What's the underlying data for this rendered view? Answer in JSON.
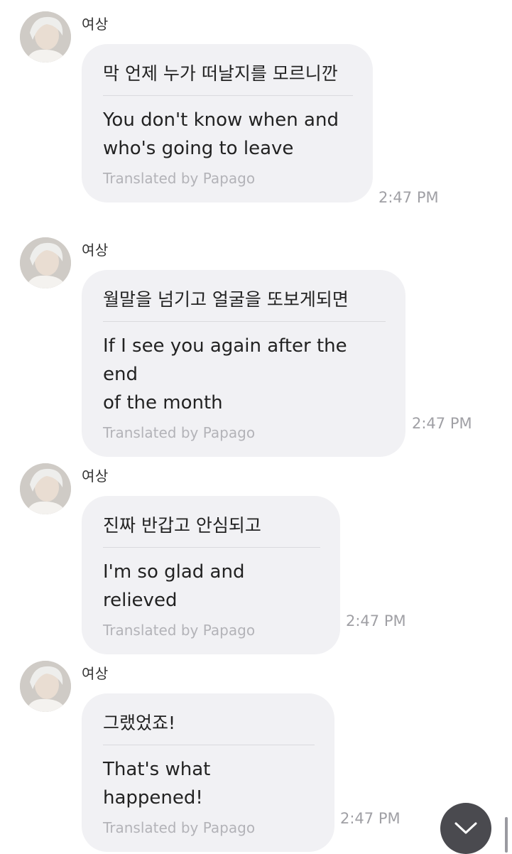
{
  "messages": [
    {
      "sender": "여상",
      "original": "막 언제 누가 떠날지를 모르니깐",
      "translation_lines": [
        "You don't know when and",
        "who's going to leave"
      ],
      "credit": "Translated by Papago",
      "time": "2:47 PM"
    },
    {
      "sender": "여상",
      "original": "월말을 넘기고 얼굴을 또보게되면",
      "translation_lines": [
        "If I see you again after the end",
        "of the month"
      ],
      "credit": "Translated by Papago",
      "time": "2:47 PM"
    },
    {
      "sender": "여상",
      "original": "진짜 반갑고 안심되고",
      "translation_lines": [
        "I'm so glad and relieved"
      ],
      "credit": "Translated by Papago",
      "time": "2:47 PM"
    },
    {
      "sender": "여상",
      "original": "그랬었죠!",
      "translation_lines": [
        "That's what happened!"
      ],
      "credit": "Translated by Papago",
      "time": "2:47 PM"
    }
  ],
  "icons": {
    "avatar": "profile-photo",
    "scroll_down": "chevron-down-icon"
  },
  "colors": {
    "bubble": "#f1f1f4",
    "scroll_button": "#4a4a4f",
    "muted_text": "#b3b3b8"
  }
}
